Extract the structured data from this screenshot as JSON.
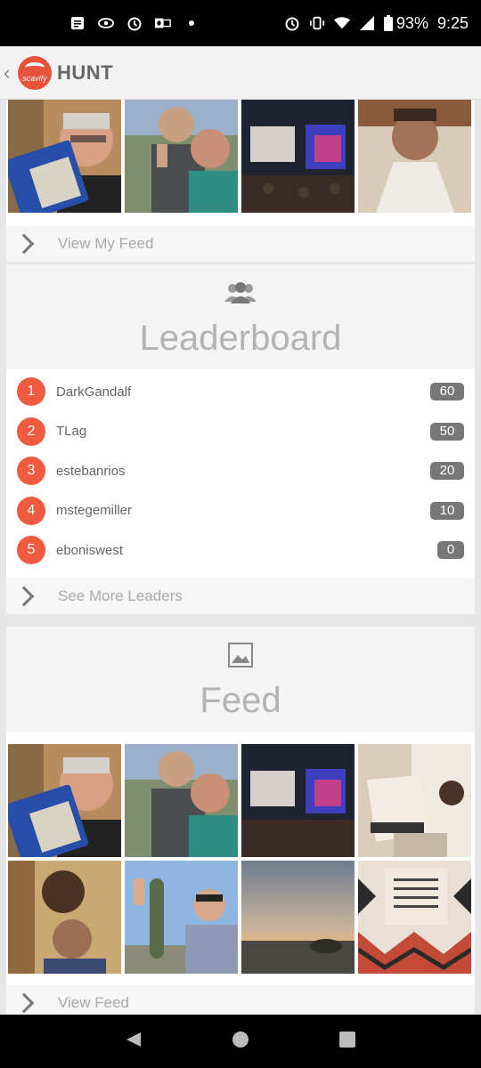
{
  "status_bar": {
    "battery_percent": "93%",
    "time": "9:25"
  },
  "header": {
    "logo_text": "scavify",
    "title": "HUNT"
  },
  "my_feed": {
    "photos": [
      "selfie-with-card",
      "selfie-two-men-thumbs-up",
      "conference-stage",
      "selfie-man-in-robe"
    ],
    "view_label": "View My Feed"
  },
  "leaderboard": {
    "title": "Leaderboard",
    "leaders": [
      {
        "rank": "1",
        "name": "DarkGandalf",
        "score": "60"
      },
      {
        "rank": "2",
        "name": "TLag",
        "score": "50"
      },
      {
        "rank": "3",
        "name": "estebanrios",
        "score": "20"
      },
      {
        "rank": "4",
        "name": "mstegemiller",
        "score": "10"
      },
      {
        "rank": "5",
        "name": "eboniswest",
        "score": "0"
      }
    ],
    "more_label": "See More Leaders"
  },
  "feed": {
    "title": "Feed",
    "row1": [
      "selfie-with-card",
      "selfie-two-men-thumbs-up",
      "conference-stage",
      "man-with-woven-blanket"
    ],
    "row2": [
      "selfie-two-men-indoors",
      "man-with-cactus",
      "desert-sunset",
      "woven-textile-sign"
    ],
    "view_label": "View Feed"
  },
  "colors": {
    "accent": "#f05a3f",
    "score_badge": "#777777",
    "section_title": "#b3b3b3"
  }
}
